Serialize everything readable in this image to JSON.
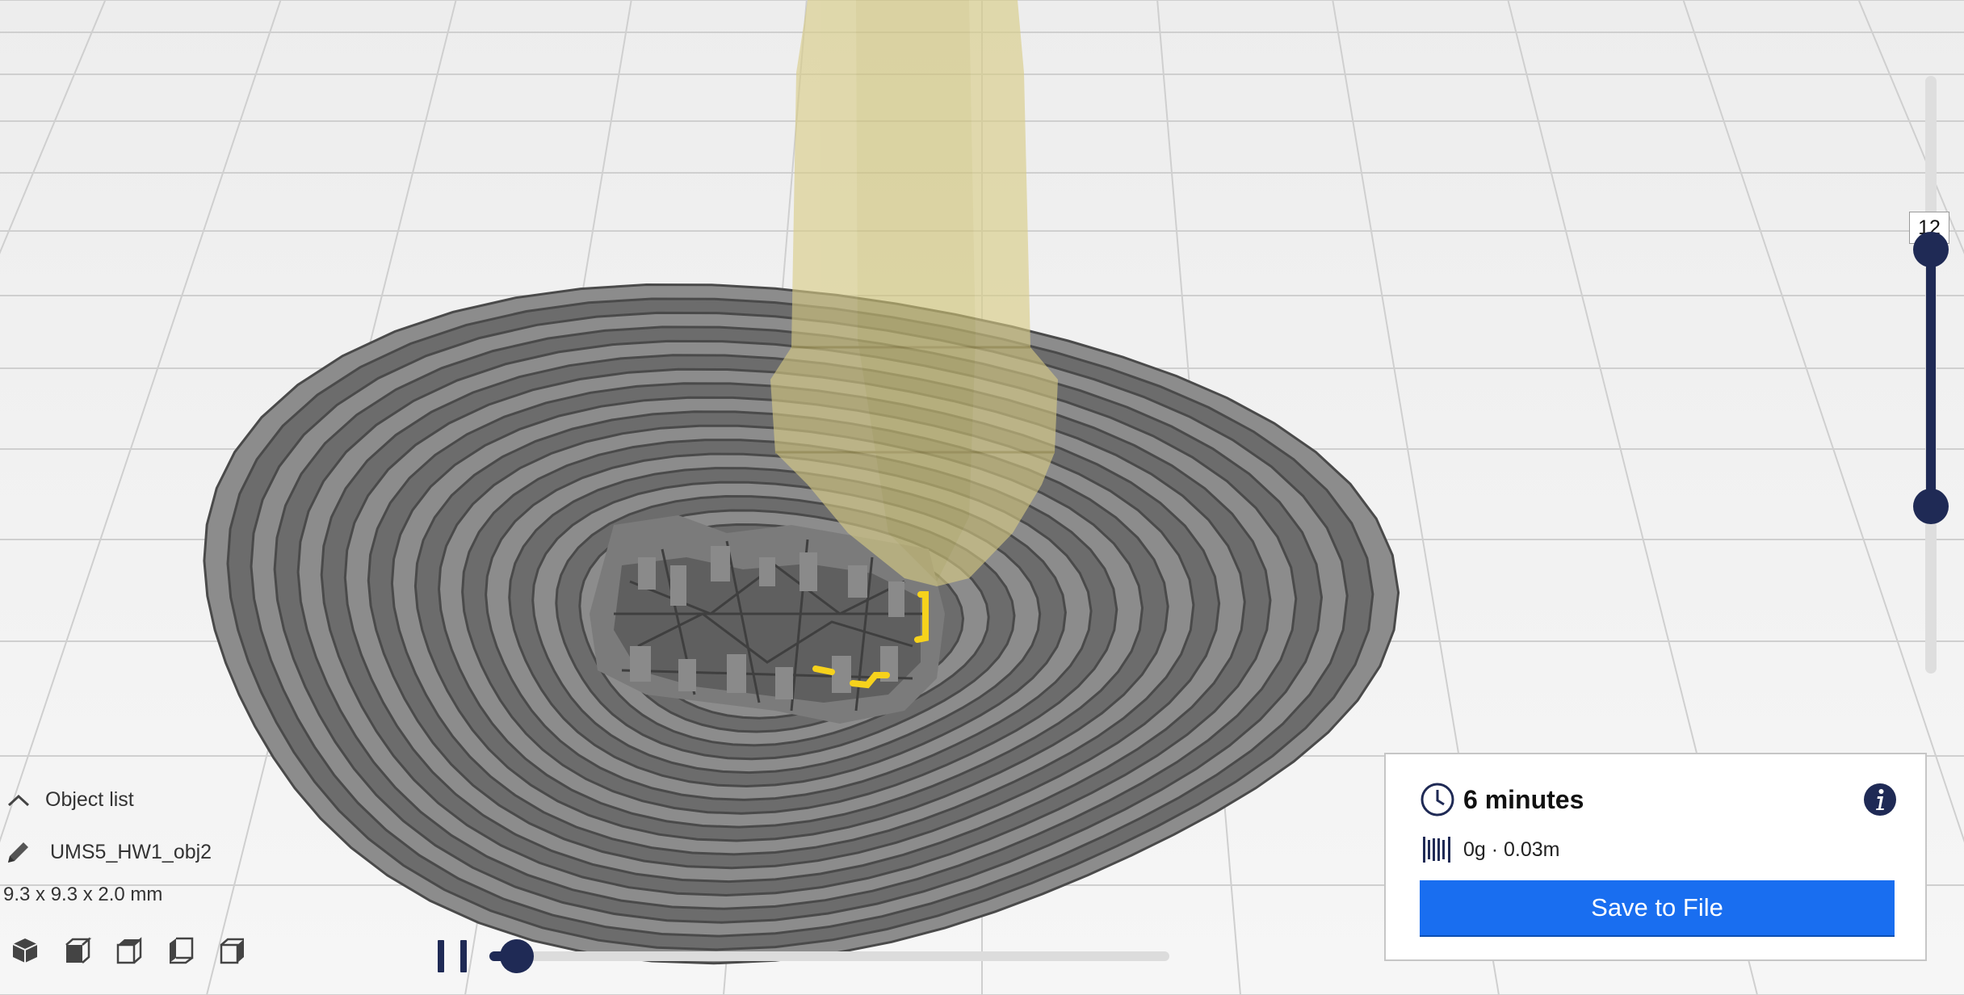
{
  "object_panel": {
    "toggle_label": "Object list",
    "object_name": "UMS5_HW1_obj2",
    "dimensions": "9.3 x 9.3 x 2.0 mm",
    "view_buttons": [
      "3d-view-icon",
      "front-view-icon",
      "top-view-icon",
      "left-view-icon",
      "right-view-icon"
    ]
  },
  "playback": {
    "pause_icon": "pause-icon",
    "progress": 0.04
  },
  "layer_slider": {
    "current_layer": "12",
    "upper_fraction": 0.29,
    "lower_fraction": 0.72
  },
  "print_info": {
    "time": "6 minutes",
    "material": "0g · 0.03m",
    "save_label": "Save to File",
    "icons": [
      "clock-icon",
      "spool-icon",
      "info-icon"
    ]
  },
  "colors": {
    "accent": "#196ef0",
    "slider": "#1f2a55",
    "toolpath": "#6a6a6a",
    "highlight": "#f6d21c",
    "nozzle": "#d8cc84",
    "grid": "#c8c8c8",
    "background": "#f2f2f2"
  }
}
